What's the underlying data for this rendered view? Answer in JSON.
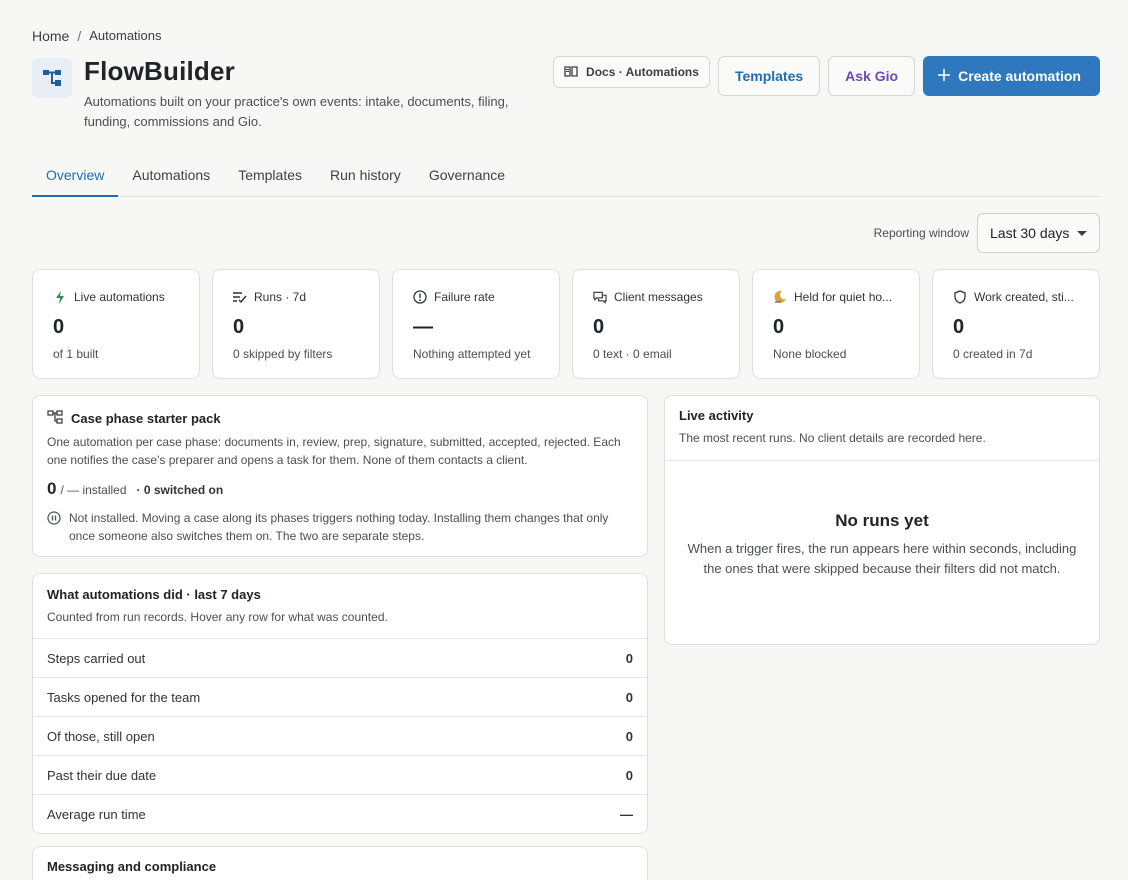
{
  "breadcrumb": {
    "home": "Home",
    "sep": "/",
    "current": "Automations"
  },
  "header": {
    "title": "FlowBuilder",
    "subtitle": "Automations built on your practice's own events: intake, documents, filing, funding, commissions and Gio.",
    "docs_label": "Docs · Automations",
    "templates_label": "Templates",
    "ask_label": "Ask Gio",
    "create_label": "Create automation",
    "colors": {
      "primary": "#2f78bd",
      "link": "#1f6fb0",
      "ask": "#6a4bb6"
    }
  },
  "tabs": [
    {
      "label": "Overview",
      "active": true
    },
    {
      "label": "Automations"
    },
    {
      "label": "Templates"
    },
    {
      "label": "Run history"
    },
    {
      "label": "Governance"
    }
  ],
  "reporting": {
    "label": "Reporting window",
    "value": "Last 30 days"
  },
  "stats": [
    {
      "icon": "bolt-icon",
      "label": "Live automations",
      "value": "0",
      "sub": "of 1 built"
    },
    {
      "icon": "list-check-icon",
      "label": "Runs · 7d",
      "value": "0",
      "sub": "0 skipped by filters"
    },
    {
      "icon": "alert-circle-icon",
      "label": "Failure rate",
      "value": "—",
      "sub": "Nothing attempted yet"
    },
    {
      "icon": "chat-icon",
      "label": "Client messages",
      "value": "0",
      "sub": "0 text · 0 email"
    },
    {
      "icon": "moon-icon",
      "label": "Held for quiet ho...",
      "value": "0",
      "sub": "None blocked"
    },
    {
      "icon": "shield-icon",
      "label": "Work created, sti...",
      "value": "0",
      "sub": "0 created in 7d"
    }
  ],
  "starter": {
    "title": "Case phase starter pack",
    "desc": "One automation per case phase: documents in, review, prep, signature, submitted, accepted, rejected. Each one notifies the case's preparer and opens a task for them. None of them contacts a client.",
    "installed_count": "0",
    "installed_text": "/ — installed",
    "switched": "· 0 switched on",
    "note": "Not installed. Moving a case along its phases triggers nothing today. Installing them changes that only once someone also switches them on. The two are separate steps."
  },
  "what": {
    "title": "What automations did · last 7 days",
    "desc": "Counted from run records. Hover any row for what was counted.",
    "rows": [
      {
        "label": "Steps carried out",
        "value": "0"
      },
      {
        "label": "Tasks opened for the team",
        "value": "0"
      },
      {
        "label": "Of those, still open",
        "value": "0"
      },
      {
        "label": "Past their due date",
        "value": "0"
      },
      {
        "label": "Average run time",
        "value": "—"
      }
    ]
  },
  "messaging": {
    "title": "Messaging and compliance"
  },
  "live": {
    "title": "Live activity",
    "desc": "The most recent runs. No client details are recorded here.",
    "empty_title": "No runs yet",
    "empty_text": "When a trigger fires, the run appears here within seconds, including the ones that were skipped because their filters did not match."
  }
}
